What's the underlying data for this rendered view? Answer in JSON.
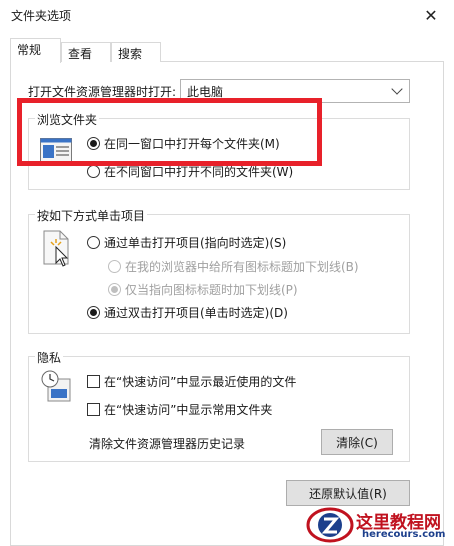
{
  "window": {
    "title": "文件夹选项",
    "close_glyph": "✕"
  },
  "tabs": [
    {
      "label": "常规",
      "active": true
    },
    {
      "label": "查看",
      "active": false
    },
    {
      "label": "搜索",
      "active": false
    }
  ],
  "open_explorer": {
    "label": "打开文件资源管理器时打开:",
    "selected": "此电脑"
  },
  "browse_folders": {
    "title": "浏览文件夹",
    "options": [
      {
        "label": "在同一窗口中打开每个文件夹(M)",
        "checked": true
      },
      {
        "label": "在不同窗口中打开不同的文件夹(W)",
        "checked": false
      }
    ]
  },
  "click_items": {
    "title": "按如下方式单击项目",
    "options": [
      {
        "label": "通过单击打开项目(指向时选定)(S)",
        "checked": false,
        "disabled": false
      },
      {
        "label": "在我的浏览器中给所有图标标题加下划线(B)",
        "checked": false,
        "disabled": true
      },
      {
        "label": "仅当指向图标标题时加下划线(P)",
        "checked": true,
        "disabled": true
      },
      {
        "label": "通过双击打开项目(单击时选定)(D)",
        "checked": true,
        "disabled": false
      }
    ]
  },
  "privacy": {
    "title": "隐私",
    "checks": [
      {
        "label": "在“快速访问”中显示最近使用的文件",
        "checked": false
      },
      {
        "label": "在“快速访问”中显示常用文件夹",
        "checked": false
      }
    ],
    "clear_label": "清除文件资源管理器历史记录",
    "clear_button": "清除(C)"
  },
  "restore_button": "还原默认值(R)",
  "watermark": {
    "title": "这里教程网",
    "url": "herecours.com"
  },
  "colors": {
    "highlight_red": "#e8212a",
    "watermark_red": "#c0121f",
    "watermark_blue": "#1c3f8c"
  }
}
